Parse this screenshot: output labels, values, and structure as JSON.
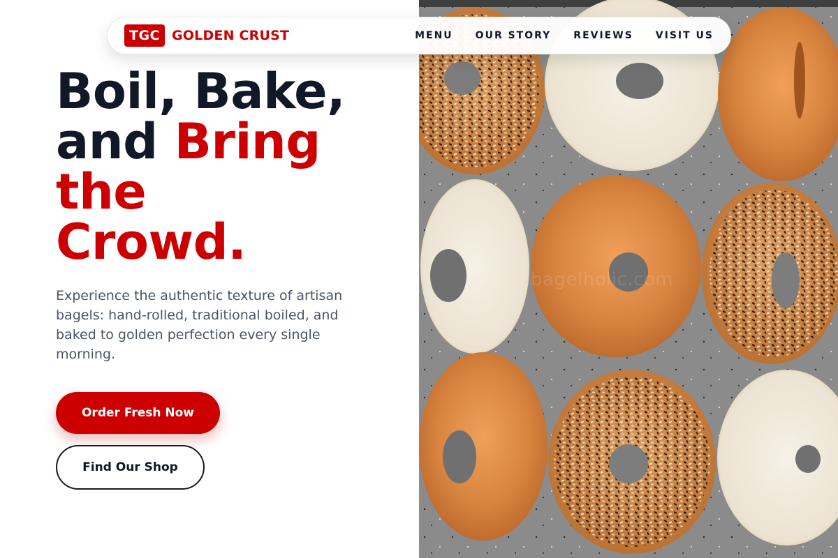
{
  "brand": {
    "logo_text": "TGC",
    "name": "GOLDEN CRUST",
    "color": "#cc0000"
  },
  "nav": {
    "items": [
      {
        "label": "MENU"
      },
      {
        "label": "OUR STORY"
      },
      {
        "label": "REVIEWS"
      },
      {
        "label": "VISIT US"
      }
    ]
  },
  "hero": {
    "headline_line1": "Boil, Bake,",
    "headline_and": "and ",
    "headline_bring": "Bring",
    "headline_the": "the",
    "headline_crowd": "Crowd.",
    "description": "Experience the authentic texture of artisan bagels: hand-rolled, traditional boiled, and baked to golden perfection every single morning.",
    "primary_cta": "Order Fresh Now",
    "secondary_cta": "Find Our Shop",
    "image_watermark": "bagelholic.com"
  },
  "colors": {
    "accent": "#cc0000",
    "heading": "#111827",
    "body_text": "#4b5563"
  }
}
